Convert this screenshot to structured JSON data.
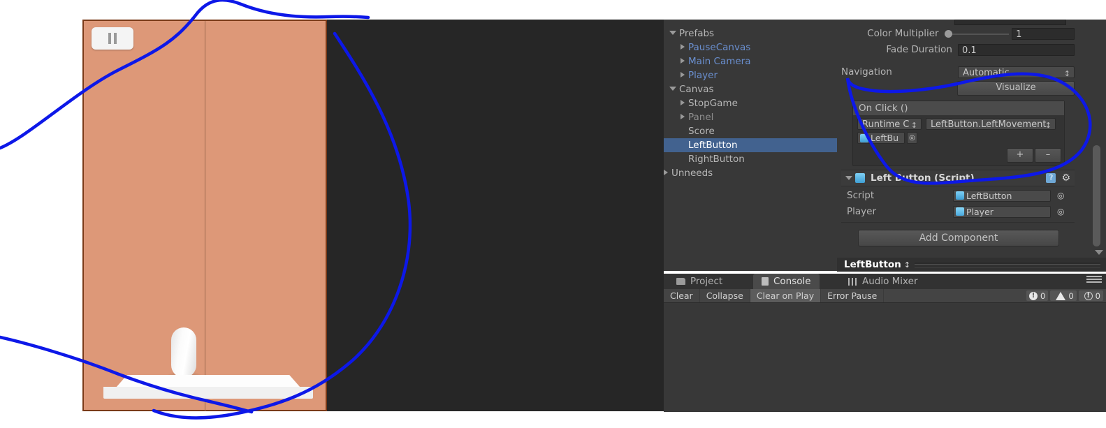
{
  "app": {
    "editor": "Unity Editor"
  },
  "game_view": {
    "pause_button_label": "II",
    "background_color": "#dd9878",
    "outside_color": "#262626",
    "player_object": "capsule-player",
    "platform_object": "platform"
  },
  "hierarchy": {
    "items": [
      {
        "label": "Prefabs",
        "indent": 0,
        "arrow": "down",
        "style": "normal",
        "selected": false
      },
      {
        "label": "PauseCanvas",
        "indent": 1,
        "arrow": "right",
        "style": "prefab",
        "selected": false
      },
      {
        "label": "Main Camera",
        "indent": 1,
        "arrow": "right",
        "style": "prefab",
        "selected": false
      },
      {
        "label": "Player",
        "indent": 1,
        "arrow": "right",
        "style": "prefab",
        "selected": false
      },
      {
        "label": "Canvas",
        "indent": 0,
        "arrow": "down",
        "style": "normal",
        "selected": false
      },
      {
        "label": "StopGame",
        "indent": 1,
        "arrow": "right",
        "style": "normal",
        "selected": false
      },
      {
        "label": "Panel",
        "indent": 1,
        "arrow": "right",
        "style": "normal",
        "selected": false
      },
      {
        "label": "Score",
        "indent": 1,
        "arrow": "none",
        "style": "normal",
        "selected": false
      },
      {
        "label": "LeftButton",
        "indent": 1,
        "arrow": "none",
        "style": "normal",
        "selected": true
      },
      {
        "label": "RightButton",
        "indent": 1,
        "arrow": "none",
        "style": "normal",
        "selected": false
      },
      {
        "label": "Unneeds",
        "indent": 0,
        "arrow": "right",
        "style": "normal",
        "selected": false
      }
    ],
    "selection_color": "#42628f",
    "prefab_color": "#6a8fcf"
  },
  "inspector": {
    "color_multiplier": {
      "label": "Color Multiplier",
      "value": "1"
    },
    "fade_duration": {
      "label": "Fade Duration",
      "value": "0.1"
    },
    "navigation": {
      "label": "Navigation",
      "value": "Automatic"
    },
    "visualize_button": "Visualize",
    "on_click": {
      "header": "On Click ()",
      "entries": [
        {
          "runtime_mode": "Runtime C",
          "function": "LeftButton.LeftMovement",
          "object": "LeftBu"
        }
      ],
      "add_label": "+",
      "remove_label": "–"
    },
    "script_component": {
      "title": "Left Button (Script)",
      "help_icon": "?",
      "fields": [
        {
          "label": "Script",
          "value": "LeftButton",
          "icon": "script-icon"
        },
        {
          "label": "Player",
          "value": "Player",
          "icon": "prefab-icon"
        }
      ]
    },
    "add_component_button": "Add Component",
    "footer_asset": "LeftButton"
  },
  "console": {
    "tabs": [
      {
        "label": "Project",
        "icon": "folder-icon",
        "active": false
      },
      {
        "label": "Console",
        "icon": "console-icon",
        "active": true
      },
      {
        "label": "Audio Mixer",
        "icon": "mixer-icon",
        "active": false
      }
    ],
    "toolbar": [
      {
        "label": "Clear",
        "active": false
      },
      {
        "label": "Collapse",
        "active": false
      },
      {
        "label": "Clear on Play",
        "active": true
      },
      {
        "label": "Error Pause",
        "active": false
      }
    ],
    "counters": [
      {
        "type": "info-icon",
        "count": "0"
      },
      {
        "type": "warning-icon",
        "count": "0"
      },
      {
        "type": "error-icon",
        "count": "0"
      }
    ],
    "log_entries": []
  },
  "annotation": {
    "color": "#0d18e8",
    "stroke_width": 4,
    "shapes": [
      "game-view-lasso",
      "on-click-lasso"
    ]
  }
}
